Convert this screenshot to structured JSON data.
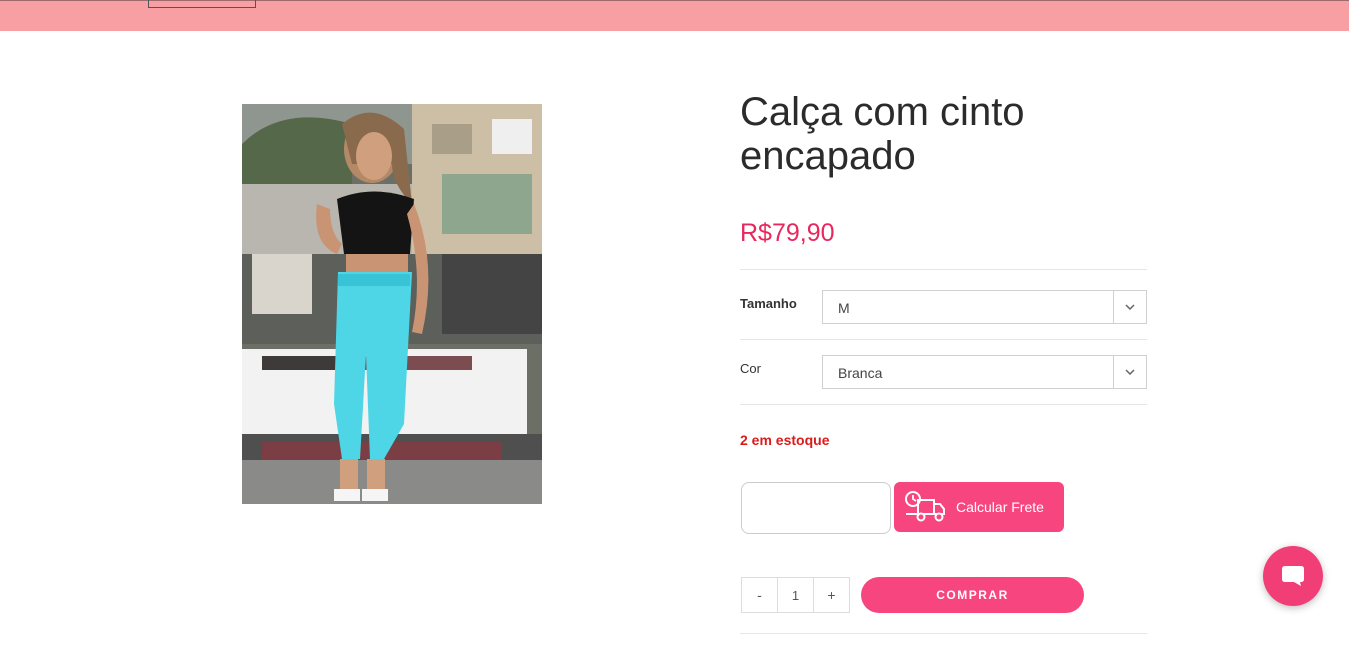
{
  "product": {
    "title": "Calça com cinto encapado",
    "price": "R$79,90",
    "image_alt": "Modelo usando calça azul com cinto encapado e blusa preta"
  },
  "options": [
    {
      "label": "Tamanho",
      "selected": "M"
    },
    {
      "label": "Cor",
      "selected": "Branca"
    }
  ],
  "stock": "2 em estoque",
  "shipping": {
    "cep_value": "",
    "button_label": "Calcular Frete",
    "icon": "delivery-truck-clock-icon"
  },
  "quantity": {
    "minus": "-",
    "value": "1",
    "plus": "+"
  },
  "buy_button": "COMPRAR",
  "chat": {
    "icon": "chat-bubble-icon"
  },
  "colors": {
    "topbar": "#f79fa3",
    "accent": "#f7467f",
    "price": "#e8285d",
    "stock": "#dd1a1a"
  }
}
